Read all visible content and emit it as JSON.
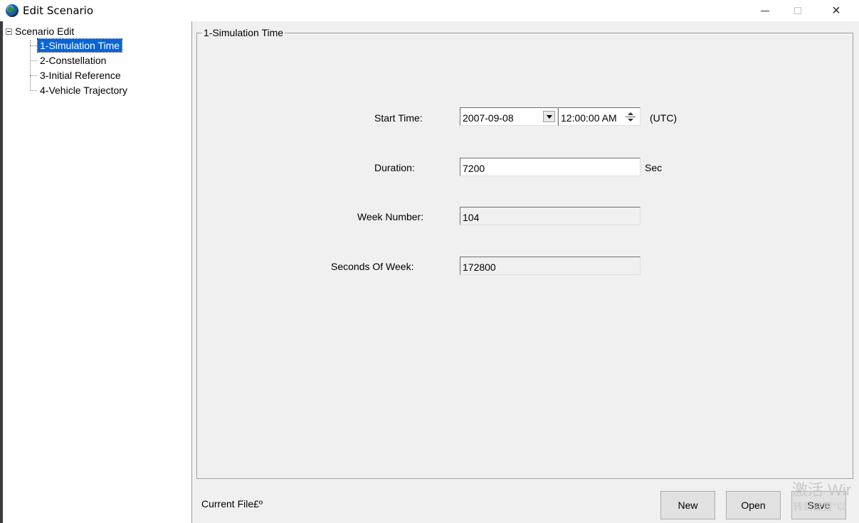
{
  "window": {
    "title": "Edit Scenario",
    "icon": "globe-icon",
    "controls": {
      "minimize": "minimize-icon",
      "maximize": "maximize-icon",
      "close": "×"
    }
  },
  "tree": {
    "root": "Scenario Edit",
    "items": [
      {
        "label": "1-Simulation Time",
        "selected": true
      },
      {
        "label": "2-Constellation",
        "selected": false
      },
      {
        "label": "3-Initial Reference",
        "selected": false
      },
      {
        "label": "4-Vehicle Trajectory",
        "selected": false
      }
    ]
  },
  "panel": {
    "title": "1-Simulation Time",
    "start_time": {
      "label": "Start Time:",
      "date": "2007-09-08",
      "time": "12:00:00 AM",
      "suffix": "(UTC)"
    },
    "duration": {
      "label": "Duration:",
      "value": "7200",
      "unit": "Sec"
    },
    "week_number": {
      "label": "Week Number:",
      "value": "104"
    },
    "seconds_of_week": {
      "label": "Seconds Of Week:",
      "value": "172800"
    }
  },
  "footer": {
    "current_file_label": "Current File£º",
    "new_label": "New",
    "open_label": "Open",
    "save_label": "Save"
  },
  "watermark": {
    "line1": "激活 Wir",
    "line2": "转到设置\"以"
  },
  "colors": {
    "selection": "#0a64d8",
    "background": "#f0f0f0"
  }
}
